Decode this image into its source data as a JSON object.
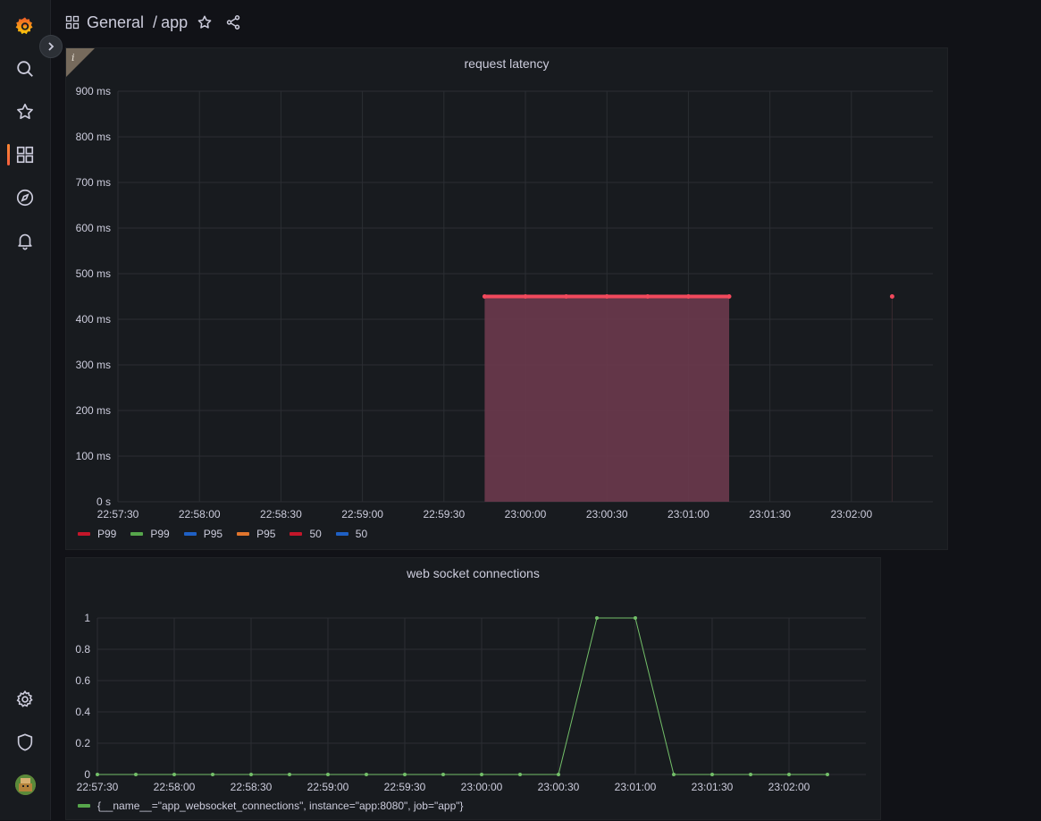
{
  "nav": {
    "items": [
      {
        "name": "grafana-logo-icon"
      },
      {
        "name": "search-icon"
      },
      {
        "name": "starred-icon"
      },
      {
        "name": "dashboards-icon"
      },
      {
        "name": "explore-icon"
      },
      {
        "name": "alerting-icon"
      },
      {
        "name": "configuration-icon"
      },
      {
        "name": "server-admin-icon"
      }
    ]
  },
  "header": {
    "folder": "General",
    "separator": "/",
    "dashboard": "app"
  },
  "colors": {
    "p99_red": "#c4162a",
    "p99_green": "#56a64b",
    "p95_blue": "#1f60c4",
    "p95_orange": "#e0752d",
    "fifty_red": "#c4162a",
    "fifty_blue": "#1f60c4",
    "latency_line": "#f2495c",
    "latency_fill": "#6b3a4d",
    "ws_line": "#73bf69"
  },
  "chart_data": [
    {
      "type": "area",
      "title": "request latency",
      "xlabel": "",
      "ylabel": "",
      "yunit": "ms",
      "ylim": [
        0,
        900
      ],
      "yticks": [
        "900 ms",
        "800 ms",
        "700 ms",
        "600 ms",
        "500 ms",
        "400 ms",
        "300 ms",
        "200 ms",
        "100 ms",
        "0 s"
      ],
      "xticks": [
        "22:57:30",
        "22:58:00",
        "22:58:30",
        "22:59:00",
        "22:59:30",
        "23:00:00",
        "23:00:30",
        "23:01:00",
        "23:01:30",
        "23:02:00"
      ],
      "xlim": [
        "22:57:30",
        "23:02:30"
      ],
      "grid": true,
      "legend_position": "bottom-left",
      "legend": [
        {
          "label": "P99",
          "color": "#c4162a"
        },
        {
          "label": "P99",
          "color": "#56a64b"
        },
        {
          "label": "P95",
          "color": "#1f60c4"
        },
        {
          "label": "P95",
          "color": "#e0752d"
        },
        {
          "label": "50",
          "color": "#c4162a"
        },
        {
          "label": "50",
          "color": "#1f60c4"
        }
      ],
      "series": [
        {
          "x": [
            "22:59:45",
            "23:00:00",
            "23:00:15",
            "23:00:30",
            "23:00:45",
            "23:01:00",
            "23:01:15"
          ],
          "values": [
            450,
            450,
            450,
            450,
            450,
            450,
            450
          ],
          "fill": true
        },
        {
          "x": [
            "23:02:15"
          ],
          "values": [
            450
          ],
          "fill": false
        }
      ]
    },
    {
      "type": "line",
      "title": "web socket connections",
      "xlabel": "",
      "ylabel": "",
      "ylim": [
        0,
        1
      ],
      "yticks": [
        "1",
        "0.8",
        "0.6",
        "0.4",
        "0.2",
        "0"
      ],
      "xticks": [
        "22:57:30",
        "22:58:00",
        "22:58:30",
        "22:59:00",
        "22:59:30",
        "23:00:00",
        "23:00:30",
        "23:01:00",
        "23:01:30",
        "23:02:00"
      ],
      "xlim": [
        "22:57:30",
        "23:02:30"
      ],
      "grid": true,
      "legend_position": "bottom-left",
      "legend": [
        {
          "label": "{__name__=\"app_websocket_connections\", instance=\"app:8080\", job=\"app\"}",
          "color": "#56a64b"
        }
      ],
      "series": [
        {
          "name": "{__name__=\"app_websocket_connections\", instance=\"app:8080\", job=\"app\"}",
          "x": [
            "22:57:30",
            "22:57:45",
            "22:58:00",
            "22:58:15",
            "22:58:30",
            "22:58:45",
            "22:59:00",
            "22:59:15",
            "22:59:30",
            "22:59:45",
            "23:00:00",
            "23:00:15",
            "23:00:30",
            "23:00:45",
            "23:01:00",
            "23:01:15",
            "23:01:30",
            "23:01:45",
            "23:02:00",
            "23:02:15"
          ],
          "values": [
            0,
            0,
            0,
            0,
            0,
            0,
            0,
            0,
            0,
            0,
            0,
            0,
            0,
            1,
            1,
            0,
            0,
            0,
            0,
            0
          ]
        }
      ]
    }
  ]
}
